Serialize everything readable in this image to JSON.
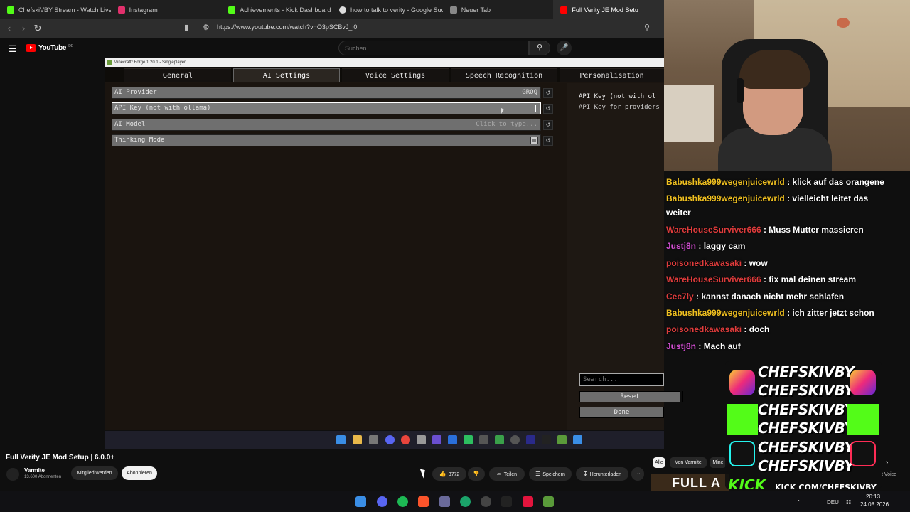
{
  "browser": {
    "tabs": [
      {
        "label": "ChefskiVBY Stream - Watch Live on K",
        "color": "#53fc18"
      },
      {
        "label": "Instagram",
        "color": "#e1306c"
      },
      {
        "label": "Achievements - Kick Dashboard",
        "color": "#53fc18"
      },
      {
        "label": "how to talk to verity - Google Suche",
        "color": "#dddddd"
      },
      {
        "label": "Neuer Tab",
        "color": "#888888"
      },
      {
        "label": "Full Verity JE Mod Setu",
        "color": "#ff0000"
      }
    ],
    "url": "https://www.youtube.com/watch?v=O3pSCBvJ_i0"
  },
  "youtube": {
    "logo": "YouTube",
    "region": "DE",
    "search_placeholder": "Suchen",
    "video_title": "Full Verity JE Mod Setup | 6.0.0+",
    "channel_name": "Varmite",
    "channel_subs": "13.600 Abonnenten",
    "join_label": "Mitglied werden",
    "subscribe_label": "Abonnieren",
    "like_count": "3772",
    "share_label": "Teilen",
    "save_label": "Speichern",
    "download_label": "Herunterladen",
    "chips": [
      "Alle",
      "Von Varmite",
      "Mine"
    ],
    "thumb_text": "FULL A",
    "thumb_side": "t Voice"
  },
  "minecraft": {
    "window_title": "Minecraft* Forge 1.20.1 - Singleplayer",
    "tabs": [
      "General",
      "AI Settings",
      "Voice Settings",
      "Speech Recognition",
      "Personalisation"
    ],
    "active_tab": "AI Settings",
    "rows": [
      {
        "label": "AI Provider",
        "value": "GROQ"
      },
      {
        "label": "API Key (not with ollama)",
        "value": ""
      },
      {
        "label": "AI Model",
        "value": "Click to type..."
      },
      {
        "label": "Thinking Mode",
        "value": ""
      }
    ],
    "desc_title": "API Key (not with ol",
    "desc_text": "API Key for providers",
    "search_placeholder": "Search...",
    "reset_label": "Reset",
    "done_label": "Done"
  },
  "chat": [
    {
      "user": "Babushka999wegenjuicewrld",
      "color": "#f0c020",
      "text": "klick auf das orangene"
    },
    {
      "user": "Babushka999wegenjuicewrld",
      "color": "#f0c020",
      "text": "vielleicht leitet das weiter"
    },
    {
      "user": "WareHouseSurviver666",
      "color": "#e03c3c",
      "text": "Muss Mutter massieren"
    },
    {
      "user": "Justj8n",
      "color": "#d44fd4",
      "text": "laggy cam"
    },
    {
      "user": "poisonedkawasaki",
      "color": "#e03c3c",
      "text": "wow"
    },
    {
      "user": "WareHouseSurviver666",
      "color": "#e03c3c",
      "text": "fix mal deinen stream"
    },
    {
      "user": "Cec7ly",
      "color": "#e03c3c",
      "text": "kannst danach nicht mehr schlafen"
    },
    {
      "user": "Babushka999wegenjuicewrld",
      "color": "#f0c020",
      "text": "ich zitter jetzt schon"
    },
    {
      "user": "poisonedkawasaki",
      "color": "#e03c3c",
      "text": "doch"
    },
    {
      "user": "Justj8n",
      "color": "#d44fd4",
      "text": "Mach auf"
    }
  ],
  "overlay": {
    "lines": [
      "CHEFSKIVBY",
      "CHEFSKIVBY",
      "CHEFSKIVBY",
      "CHEFSKIVBY",
      "CHEFSKIVBY",
      "CHEFSKIVBY"
    ],
    "kick": "KICK",
    "url": "KICK.COM/CHEFSKIVBY"
  },
  "system": {
    "lang": "DEU",
    "time": "20:13",
    "date": "24.08.2026"
  }
}
